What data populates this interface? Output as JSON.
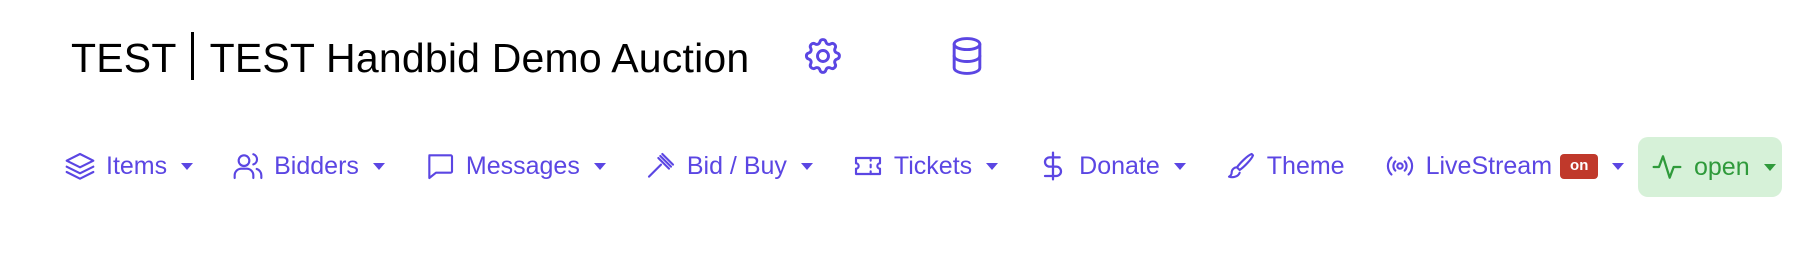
{
  "header": {
    "org": "TEST",
    "auction_name": "TEST Handbid Demo Auction",
    "settings_icon": "gear-icon",
    "database_icon": "database-icon"
  },
  "nav": {
    "items": [
      {
        "label": "Items",
        "icon": "layers-icon",
        "has_dropdown": true
      },
      {
        "label": "Bidders",
        "icon": "users-icon",
        "has_dropdown": true
      },
      {
        "label": "Messages",
        "icon": "message-square-icon",
        "has_dropdown": true
      },
      {
        "label": "Bid / Buy",
        "icon": "gavel-icon",
        "has_dropdown": true
      },
      {
        "label": "Tickets",
        "icon": "ticket-icon",
        "has_dropdown": true
      },
      {
        "label": "Donate",
        "icon": "dollar-sign-icon",
        "has_dropdown": true
      },
      {
        "label": "Theme",
        "icon": "brush-icon",
        "has_dropdown": false
      },
      {
        "label": "LiveStream",
        "icon": "broadcast-icon",
        "has_dropdown": true,
        "badge": "on"
      }
    ],
    "status": {
      "label": "open",
      "icon": "activity-icon",
      "has_dropdown": true
    }
  },
  "colors": {
    "accent": "#5b46e3",
    "status_green": "#2f9a3b",
    "status_bg": "#d6f1d8",
    "badge_red": "#c0392b"
  }
}
